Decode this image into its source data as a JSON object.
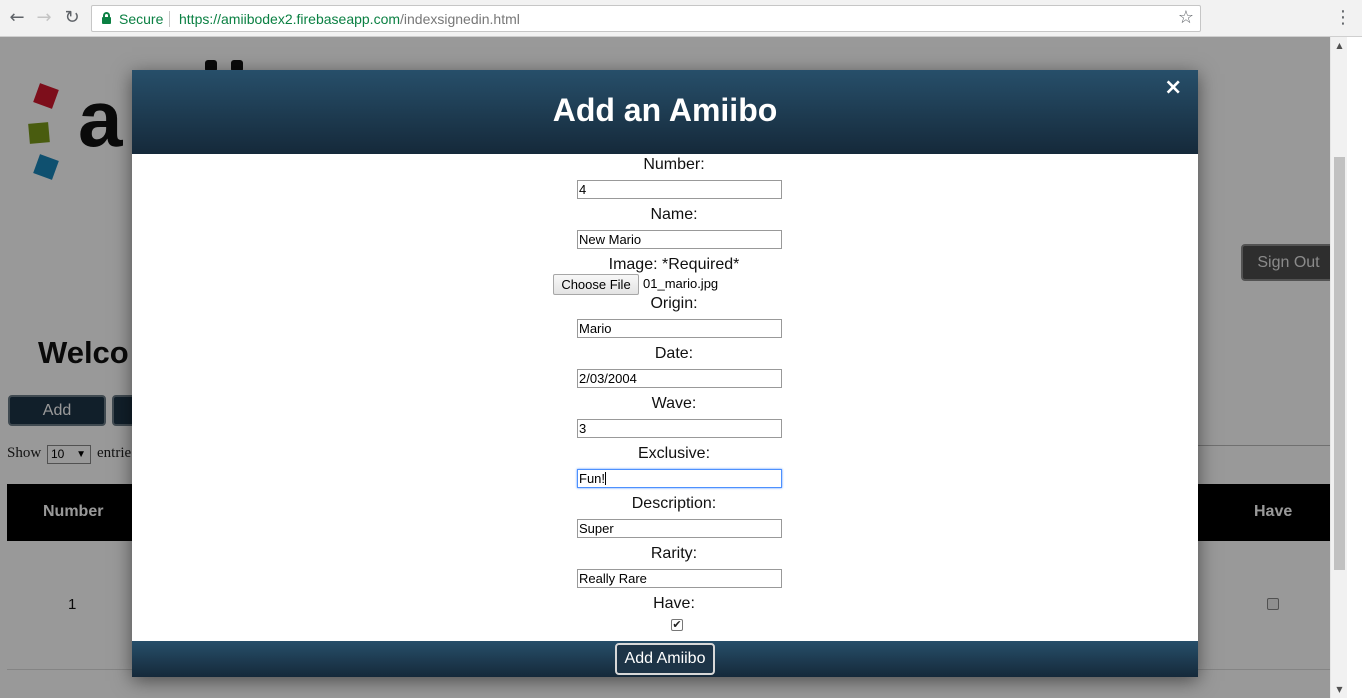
{
  "browser": {
    "secure_label": "Secure",
    "url_host": "https://amiibodex2.firebaseapp.com",
    "url_path": "/indexsignedin.html"
  },
  "page": {
    "welcome": "Welco",
    "add_button": "Add",
    "show_label": "Show",
    "entries_value": "10",
    "entries_label": "entrie",
    "sign_out": "Sign Out",
    "table": {
      "headers": [
        "Number",
        "Have"
      ],
      "rows": [
        {
          "number": "1"
        }
      ]
    }
  },
  "modal": {
    "title": "Add an Amiibo",
    "close": "×",
    "fields": {
      "number": {
        "label": "Number:",
        "value": "4"
      },
      "name": {
        "label": "Name:",
        "value": "New Mario"
      },
      "image": {
        "label": "Image: *Required*",
        "button": "Choose File",
        "file": "01_mario.jpg"
      },
      "origin": {
        "label": "Origin:",
        "value": "Mario"
      },
      "date": {
        "label": "Date:",
        "value": "2/03/2004"
      },
      "wave": {
        "label": "Wave:",
        "value": "3"
      },
      "exclusive": {
        "label": "Exclusive:",
        "value": "Fun!"
      },
      "description": {
        "label": "Description:",
        "value": "Super"
      },
      "rarity": {
        "label": "Rarity:",
        "value": "Really Rare"
      },
      "have": {
        "label": "Have:",
        "checked": true
      }
    },
    "submit": "Add Amiibo"
  },
  "colors": {
    "header_top": "#274f6a",
    "header_bottom": "#15293a",
    "secure_green": "#0b8043",
    "logo_red": "#d0182e",
    "logo_green": "#7a9a1a",
    "logo_blue": "#1a85b9"
  }
}
